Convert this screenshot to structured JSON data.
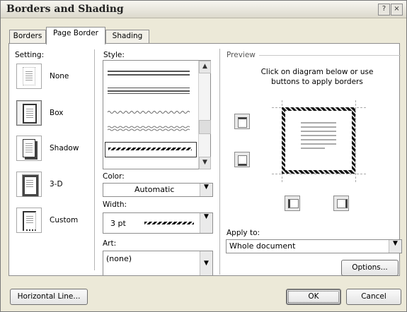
{
  "window": {
    "title": "Borders and Shading",
    "help_glyph": "?",
    "close_glyph": "×"
  },
  "tabs": [
    {
      "label": "Borders",
      "active": false
    },
    {
      "label": "Page Border",
      "active": true
    },
    {
      "label": "Shading",
      "active": false
    }
  ],
  "setting": {
    "label": "Setting:",
    "options": [
      {
        "label": "None",
        "icon": "none-setting-icon"
      },
      {
        "label": "Box",
        "icon": "box-setting-icon",
        "selected": true
      },
      {
        "label": "Shadow",
        "icon": "shadow-setting-icon"
      },
      {
        "label": "3-D",
        "icon": "3d-setting-icon"
      },
      {
        "label": "Custom",
        "icon": "custom-setting-icon"
      }
    ]
  },
  "style": {
    "label": "Style:"
  },
  "color": {
    "label": "Color:",
    "value": "Automatic"
  },
  "width": {
    "label": "Width:",
    "value": "3 pt"
  },
  "art": {
    "label": "Art:",
    "value": "(none)"
  },
  "preview": {
    "label": "Preview",
    "instructions": "Click on diagram below or use buttons to apply borders"
  },
  "apply_to": {
    "label": "Apply to:",
    "value": "Whole document"
  },
  "buttons": {
    "options": "Options...",
    "horizontal_line": "Horizontal Line...",
    "ok": "OK",
    "cancel": "Cancel"
  },
  "colors": {
    "dialog_bg": "#ece9d8",
    "panel_bg": "#ffffff",
    "border_gray": "#8e8e8e"
  }
}
